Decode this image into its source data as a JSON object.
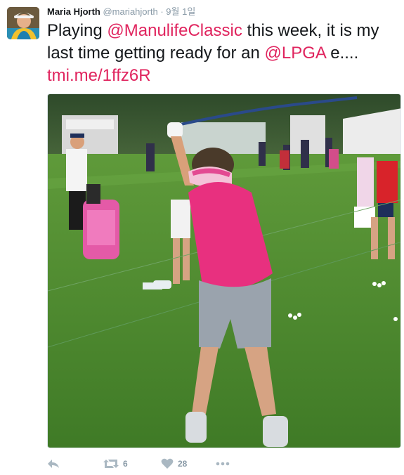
{
  "tweet": {
    "author_name": "Maria Hjorth",
    "author_handle": "@mariahjorth",
    "separator": "·",
    "date": "9월 1일",
    "text_parts": {
      "p1": "Playing ",
      "mention1": "@ManulifeClassic",
      "p2": " this week, it is my last time getting ready for an ",
      "mention2": "@LPGA",
      "p3": " e.... ",
      "link": "tmi.me/1ffz6R"
    }
  },
  "actions": {
    "reply_icon": "reply-icon",
    "retweet_icon": "retweet-icon",
    "retweet_count": "6",
    "like_icon": "heart-icon",
    "like_count": "28",
    "more_icon": "more-dots-icon"
  },
  "colors": {
    "link": "#e0245e",
    "muted": "#8899a6",
    "text": "#14171a"
  }
}
